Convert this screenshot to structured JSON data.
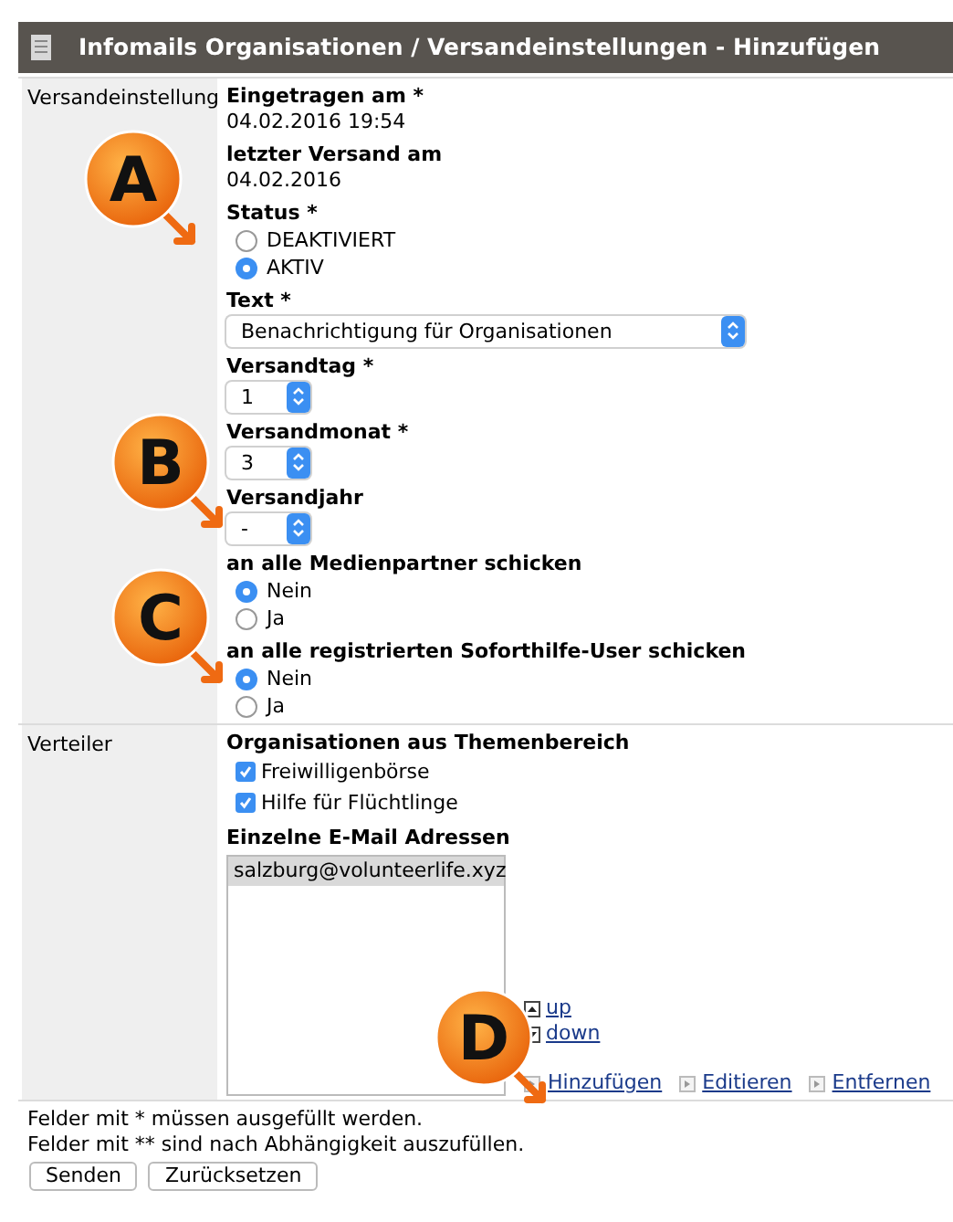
{
  "header": {
    "title": "Infomails Organisationen / Versandeinstellungen - Hinzufügen"
  },
  "sections": [
    {
      "label": "Versandeinstellung",
      "fields": [
        {
          "kind": "info",
          "label": "Eingetragen am *",
          "value": "04.02.2016 19:54"
        },
        {
          "kind": "info",
          "label": "letzter Versand am",
          "value": "04.02.2016"
        },
        {
          "kind": "radio",
          "label": "Status *",
          "options": [
            {
              "label": "DEAKTIVIERT",
              "selected": false
            },
            {
              "label": "AKTIV",
              "selected": true
            }
          ]
        },
        {
          "kind": "wide_select",
          "label": "Text *",
          "value": "Benachrichtigung für Organisationen"
        },
        {
          "kind": "select",
          "label": "Versandtag *",
          "value": "1"
        },
        {
          "kind": "select",
          "label": "Versandmonat *",
          "value": "3"
        },
        {
          "kind": "select",
          "label": "Versandjahr",
          "value": "-"
        },
        {
          "kind": "radio",
          "label": "an alle Medienpartner schicken",
          "options": [
            {
              "label": "Nein",
              "selected": true
            },
            {
              "label": "Ja",
              "selected": false
            }
          ]
        },
        {
          "kind": "radio",
          "label": "an alle registrierten Soforthilfe-User schicken",
          "options": [
            {
              "label": "Nein",
              "selected": true
            },
            {
              "label": "Ja",
              "selected": false
            }
          ]
        }
      ]
    },
    {
      "label": "Verteiler",
      "fields": [
        {
          "kind": "checkboxes",
          "label": "Organisationen aus Themenbereich",
          "options": [
            {
              "label": "Freiwilligenbörse",
              "checked": true
            },
            {
              "label": "Hilfe für Flüchtlinge",
              "checked": true
            }
          ]
        },
        {
          "kind": "listbox",
          "label": "Einzelne E-Mail Adressen",
          "items": [
            {
              "text": "salzburg@volunteerlife.xyz",
              "selected": true
            }
          ],
          "order": [
            "up",
            "down"
          ],
          "actions": [
            "Hinzufügen",
            "Editieren",
            "Entfernen"
          ]
        }
      ]
    }
  ],
  "notes": [
    "Felder mit * müssen ausgefüllt werden.",
    "Felder mit ** sind nach Abhängigkeit auszufüllen."
  ],
  "buttons": [
    "Senden",
    "Zurücksetzen"
  ],
  "markers": [
    {
      "label": "A"
    },
    {
      "label": "B"
    },
    {
      "label": "C"
    },
    {
      "label": "D"
    }
  ]
}
